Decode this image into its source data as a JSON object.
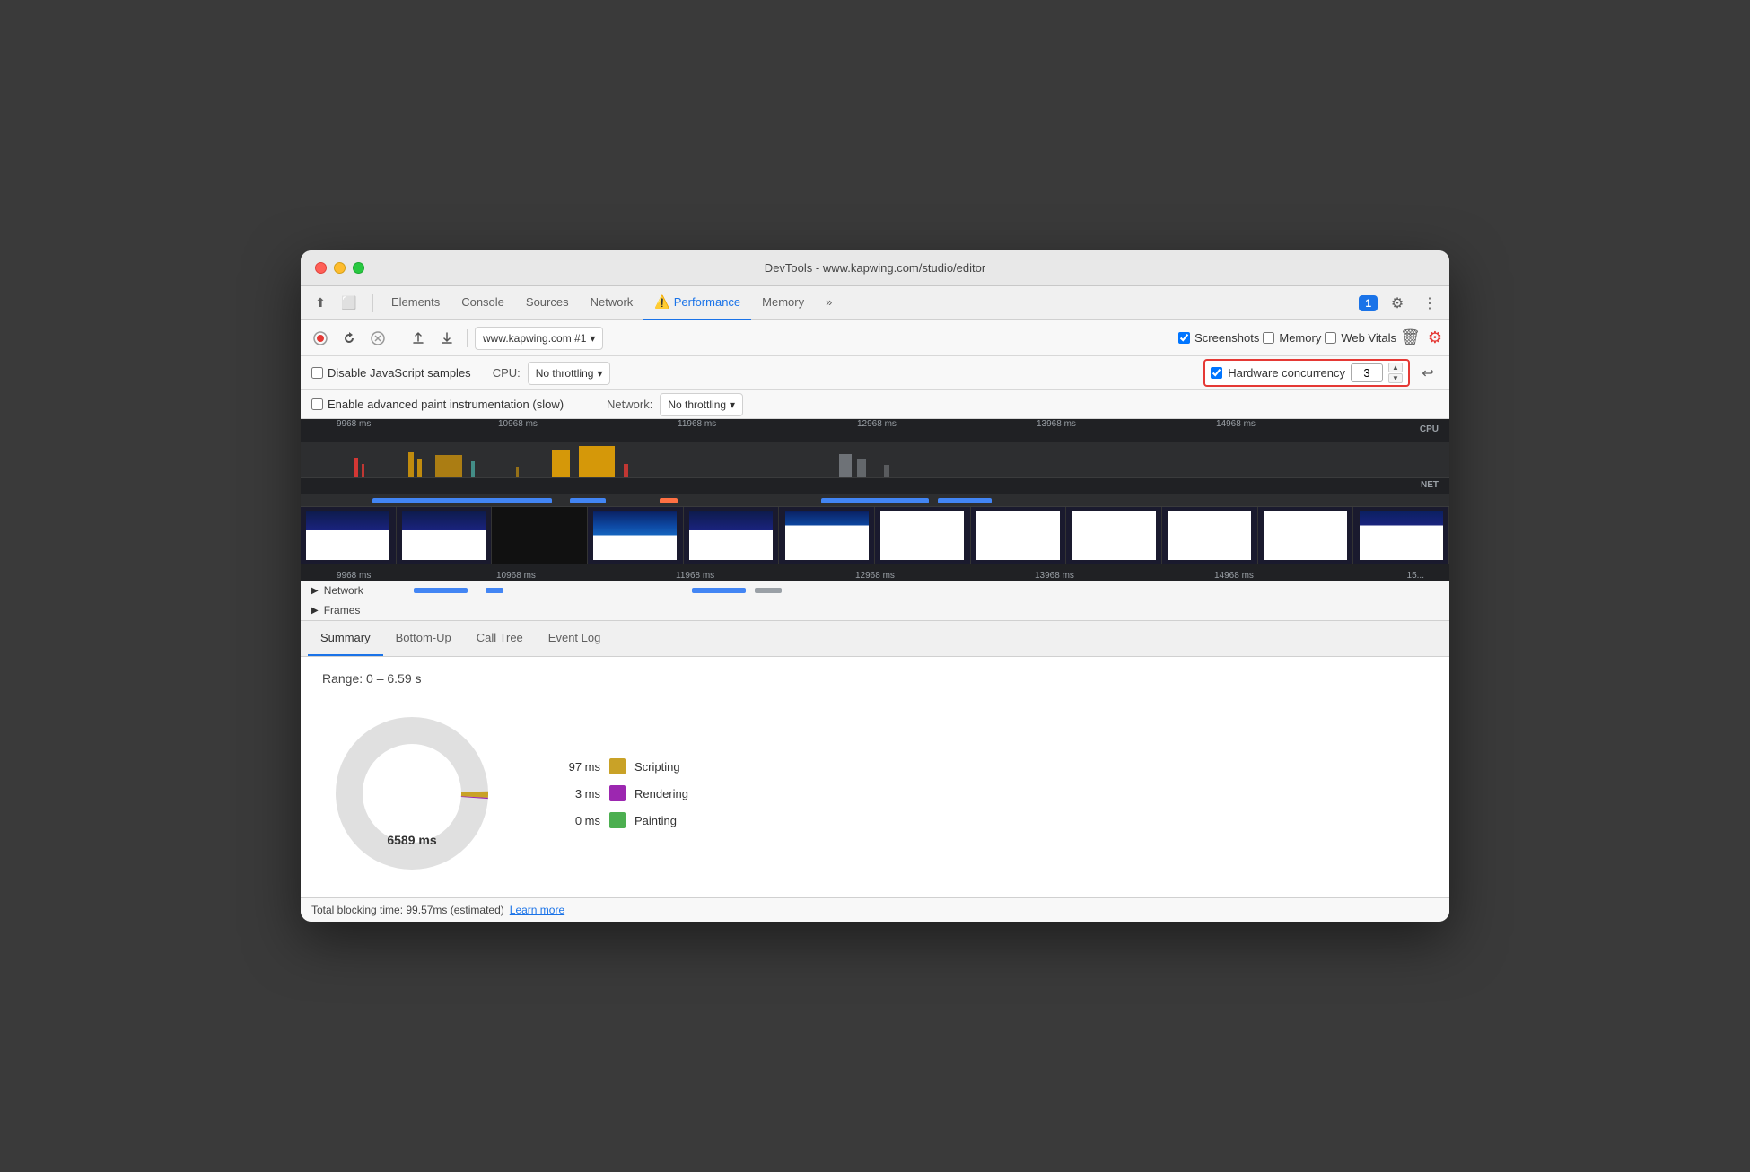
{
  "window": {
    "title": "DevTools - www.kapwing.com/studio/editor"
  },
  "tabs": {
    "items": [
      {
        "label": "Elements",
        "active": false
      },
      {
        "label": "Console",
        "active": false
      },
      {
        "label": "Sources",
        "active": false
      },
      {
        "label": "Network",
        "active": false
      },
      {
        "label": "Performance",
        "active": true
      },
      {
        "label": "Memory",
        "active": false
      }
    ],
    "overflow": "»",
    "badge": "1"
  },
  "toolbar": {
    "record_label": "Record",
    "reload_label": "Reload",
    "clear_label": "Clear",
    "upload_label": "Upload",
    "download_label": "Download",
    "target": "www.kapwing.com #1",
    "screenshots_label": "Screenshots",
    "memory_label": "Memory",
    "web_vitals_label": "Web Vitals"
  },
  "settings": {
    "disable_js_label": "Disable JavaScript samples",
    "enable_paint_label": "Enable advanced paint instrumentation (slow)",
    "cpu_label": "CPU:",
    "cpu_value": "No throttling",
    "network_label": "Network:",
    "network_value": "No throttling",
    "hw_concurrency_label": "Hardware concurrency",
    "hw_concurrency_value": "3"
  },
  "timeline": {
    "labels": [
      "9968 ms",
      "10968 ms",
      "11968 ms",
      "12968 ms",
      "13968 ms",
      "14968 ms"
    ],
    "labels_bottom": [
      "9968 ms",
      "10968 ms",
      "11968 ms",
      "12968 ms",
      "13968 ms",
      "14968 ms",
      "15..."
    ],
    "cpu_label": "CPU",
    "net_label": "NET"
  },
  "panel": {
    "network_label": "Network",
    "frames_label": "Frames"
  },
  "bottom_tabs": {
    "items": [
      {
        "label": "Summary",
        "active": true
      },
      {
        "label": "Bottom-Up",
        "active": false
      },
      {
        "label": "Call Tree",
        "active": false
      },
      {
        "label": "Event Log",
        "active": false
      }
    ]
  },
  "summary": {
    "range_label": "Range: 0 – 6.59 s",
    "center_value": "6589 ms",
    "legend": [
      {
        "value": "97 ms",
        "name": "Scripting",
        "color": "#c9a227"
      },
      {
        "value": "3 ms",
        "name": "Rendering",
        "color": "#9c27b0"
      },
      {
        "value": "0 ms",
        "name": "Painting",
        "color": "#4caf50"
      }
    ]
  },
  "status_bar": {
    "text": "Total blocking time: 99.57ms (estimated)",
    "link": "Learn more"
  }
}
